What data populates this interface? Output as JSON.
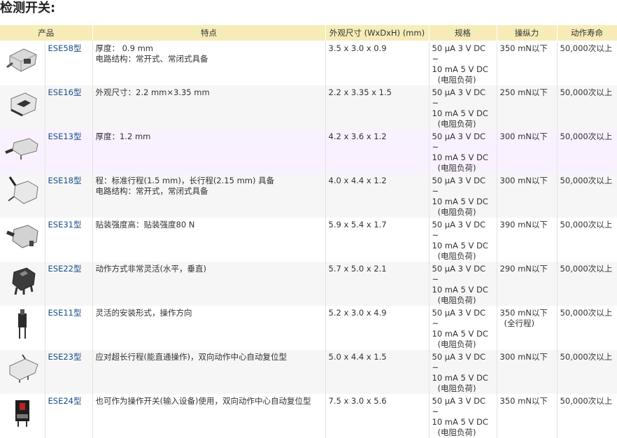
{
  "page_title": "检测开关:",
  "headers": {
    "product": "产品",
    "features": "特点",
    "dimensions": "外观尺寸 (WxDxH) (mm)",
    "rating": "规格",
    "force": "操纵力",
    "life": "动作寿命"
  },
  "rows": [
    {
      "model": "ESE58型",
      "feature_1": "厚度： 0.9 mm",
      "feature_2": "电路结构：常开式、常闭式具备",
      "dims": "3.5 x 3.0 x 0.9",
      "rating_1": "50 μA 3 V DC ~",
      "rating_2": "10 mA 5 V DC",
      "rating_3": "(电阻负荷)",
      "force_1": "350 mN以下",
      "force_2": "",
      "life": "50,000次以上"
    },
    {
      "model": "ESE16型",
      "feature_1": "外观尺寸：2.2 mm×3.35 mm",
      "feature_2": "",
      "dims": "2.2 x 3.35 x 1.5",
      "rating_1": "50 μA 3 V DC ~",
      "rating_2": "10 mA 5 V DC",
      "rating_3": "(电阻负荷)",
      "force_1": "250 mN以下",
      "force_2": "",
      "life": "50,000次以上"
    },
    {
      "model": "ESE13型",
      "feature_1": "厚度：1.2 mm",
      "feature_2": "",
      "dims": "4.2 x 3.6 x 1.2",
      "rating_1": "50 μA 3 V DC ~",
      "rating_2": "10 mA 5 V DC",
      "rating_3": "(电阻负荷)",
      "force_1": "300 mN以下",
      "force_2": "",
      "life": "50,000次以上"
    },
    {
      "model": "ESE18型",
      "feature_1": "程：标准行程(1.5 mm)，长行程(2.15 mm) 具备",
      "feature_2": "电路结构：常开式，常闭式具备",
      "dims": "4.0 x 4.4 x 1.2",
      "rating_1": "50 μA 3 V DC ~",
      "rating_2": "10 mA 5 V DC",
      "rating_3": "(电阻负荷)",
      "force_1": "300 mN以下",
      "force_2": "",
      "life": "50,000次以上"
    },
    {
      "model": "ESE31型",
      "feature_1": "贴装强度高：贴装强度80 N",
      "feature_2": "",
      "dims": "5.9 x 5.4 x 1.7",
      "rating_1": "50 μA 3 V DC ~",
      "rating_2": "10 mA 5 V DC",
      "rating_3": "(电阻负荷)",
      "force_1": "390 mN以下",
      "force_2": "",
      "life": "50,000次以上"
    },
    {
      "model": "ESE22型",
      "feature_1": "动作方式非常灵活(水平，垂直)",
      "feature_2": "",
      "dims": "5.7 x 5.0 x 2.1",
      "rating_1": "50 μA 3 V DC ~",
      "rating_2": "10 mA 5 V DC",
      "rating_3": "(电阻负荷)",
      "force_1": "290 mN以下",
      "force_2": "",
      "life": "50,000次以上"
    },
    {
      "model": "ESE11型",
      "feature_1": "灵活的安装形式，操作方向",
      "feature_2": "",
      "dims": "5.2 x 3.0 x 4.9",
      "rating_1": "50 μA 3 V DC ~",
      "rating_2": "10 mA 5 V DC",
      "rating_3": "(电阻负荷)",
      "force_1": "350 mN以下",
      "force_2": "(全行程)",
      "life": "50,000次以上"
    },
    {
      "model": "ESE23型",
      "feature_1": "应对超长行程(能直通操作)，双向动作中心自动复位型",
      "feature_2": "",
      "dims": "5.0 x 4.4 x 1.5",
      "rating_1": "50 μA 3 V DC ~",
      "rating_2": "10 mA 5 V DC",
      "rating_3": "(电阻负荷)",
      "force_1": "300 mN以下",
      "force_2": "",
      "life": "50,000次以上"
    },
    {
      "model": "ESE24型",
      "feature_1": "也可作为操作开关(输入设备)使用，双向动作中心自动复位型",
      "feature_2": "",
      "dims": "7.5 x 3.0 x 5.6",
      "rating_1": "50 μA 3 V DC ~",
      "rating_2": "10 mA 5 V DC",
      "rating_3": "(电阻负荷)",
      "force_1": "350 mN以下",
      "force_2": "",
      "life": "50,000次以上"
    }
  ]
}
